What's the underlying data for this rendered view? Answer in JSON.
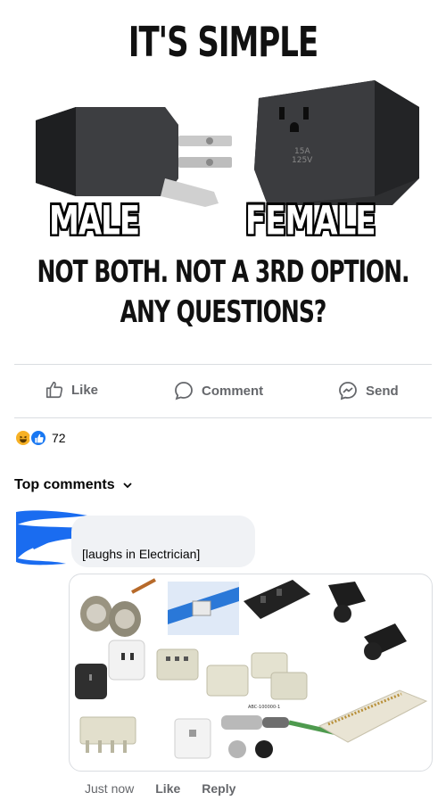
{
  "meme": {
    "title": "IT'S SIMPLE",
    "male_label": "MALE",
    "female_label": "FEMALE",
    "line1": "NOT BOTH. NOT A 3RD OPTION.",
    "line2": "ANY QUESTIONS?"
  },
  "actions": {
    "like": "Like",
    "comment": "Comment",
    "send": "Send"
  },
  "reactions": {
    "count": "72",
    "types": [
      "haha",
      "like"
    ]
  },
  "comments": {
    "header": "Top comments",
    "items": [
      {
        "text": "[laughs in Electrician]",
        "time": "Just now",
        "like": "Like",
        "reply": "Reply"
      }
    ]
  },
  "colors": {
    "accent": "#1877f2",
    "muted": "#65676b",
    "bubble": "#f0f2f5",
    "scribble": "#1a6cf0"
  }
}
